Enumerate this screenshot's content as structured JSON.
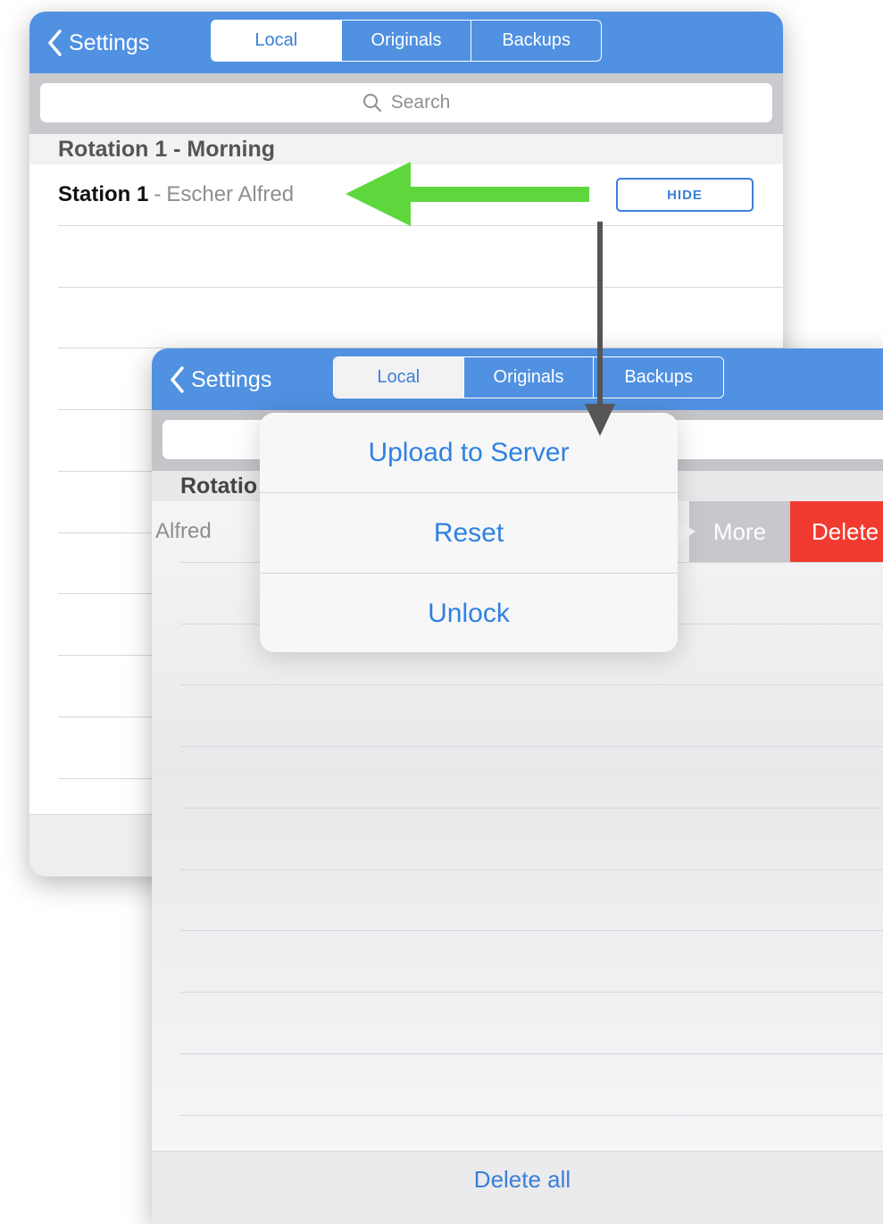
{
  "back_panel": {
    "nav": {
      "back_label": "Settings"
    },
    "tabs": [
      {
        "label": "Local",
        "active": true
      },
      {
        "label": "Originals",
        "active": false
      },
      {
        "label": "Backups",
        "active": false
      }
    ],
    "search": {
      "placeholder": "Search"
    },
    "section_header": "Rotation 1 - Morning",
    "row": {
      "title": "Station 1",
      "separator": "-",
      "subtitle": "Escher Alfred"
    },
    "hide_button": "HIDE"
  },
  "front_panel": {
    "nav": {
      "back_label": "Settings"
    },
    "tabs": [
      {
        "label": "Local",
        "active": true
      },
      {
        "label": "Originals",
        "active": false
      },
      {
        "label": "Backups",
        "active": false
      }
    ],
    "section_header_partial": "Rotatio",
    "row_partial": "Alfred",
    "swipe_actions": {
      "more": "More",
      "delete": "Delete"
    },
    "popover": {
      "items": [
        "Upload to Server",
        "Reset",
        "Unlock"
      ]
    },
    "footer": {
      "delete_all": "Delete all"
    }
  },
  "colors": {
    "nav_blue": "#5091e1",
    "accent_blue": "#3b7fd8",
    "delete_red": "#f23b30",
    "more_gray": "#c7c7cc",
    "annotation_green": "#5ed73c",
    "annotation_gray": "#555555"
  },
  "icons": [
    "chevron-left-icon",
    "search-icon"
  ]
}
